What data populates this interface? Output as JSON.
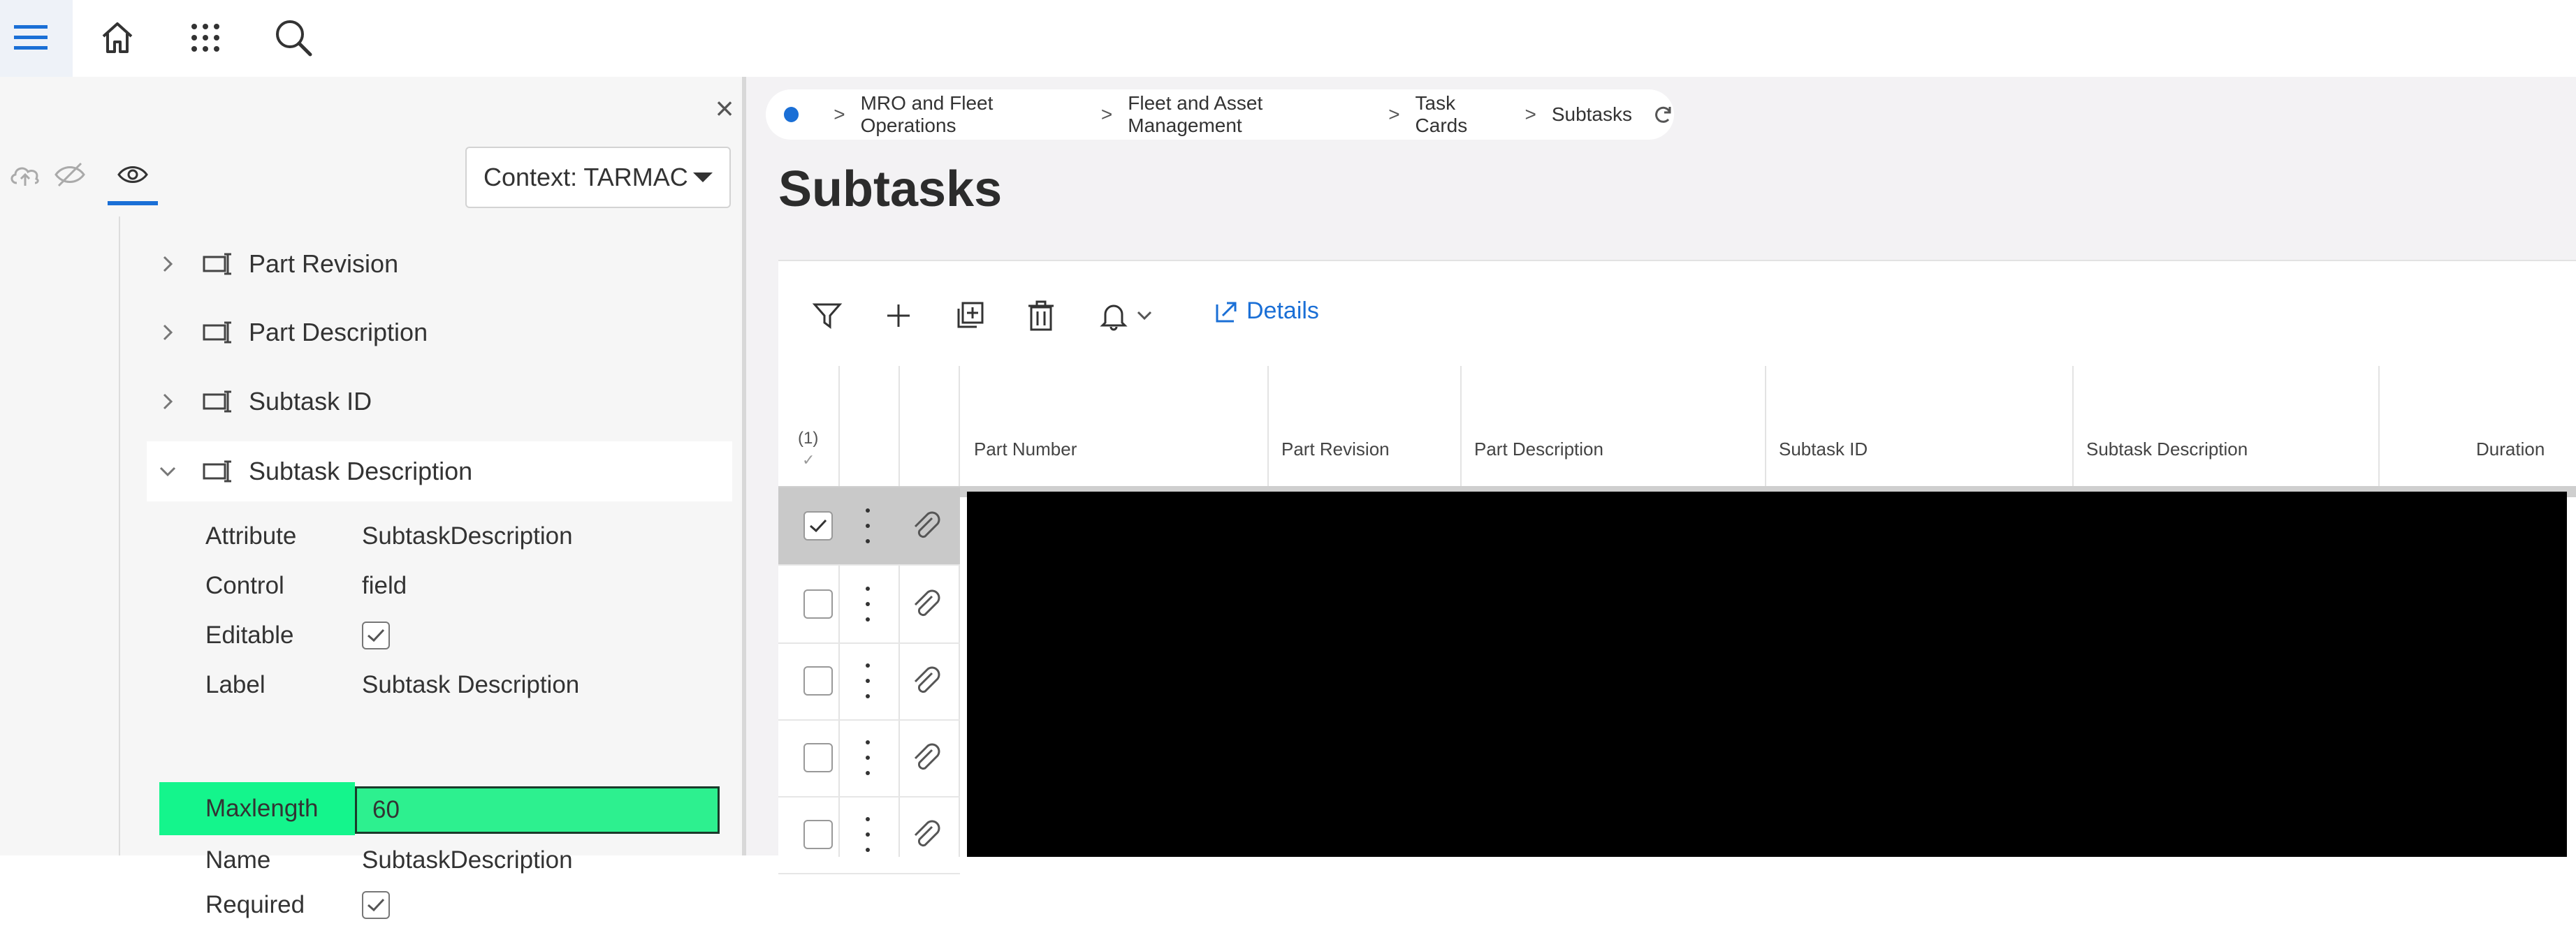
{
  "topbar": {
    "icons": [
      "hamburger-menu-icon",
      "home-icon",
      "apps-grid-icon",
      "search-icon"
    ]
  },
  "panel": {
    "close_label": "×",
    "view_icons": [
      "cloud-upload-icon",
      "eye-off-icon",
      "eye-icon"
    ],
    "context_label": "Context: TARMAC",
    "tree": [
      {
        "label": "Part Revision",
        "expanded": false
      },
      {
        "label": "Part Description",
        "expanded": false
      },
      {
        "label": "Subtask ID",
        "expanded": false
      },
      {
        "label": "Subtask Description",
        "expanded": true
      }
    ],
    "properties": [
      {
        "key": "Attribute",
        "value": "SubtaskDescription"
      },
      {
        "key": "Control",
        "value": "field"
      },
      {
        "key": "Editable",
        "value": "",
        "checkbox": true
      },
      {
        "key": "Label",
        "value": "Subtask Description"
      },
      {
        "key": "Maxlength",
        "value": "60",
        "highlight": true
      },
      {
        "key": "Name",
        "value": "SubtaskDescription"
      },
      {
        "key": "Required",
        "value": "",
        "checkbox": true
      }
    ]
  },
  "breadcrumb": {
    "items": [
      "MRO and Fleet Operations",
      "Fleet and Asset Management",
      "Task Cards",
      "Subtasks"
    ],
    "separator": ">"
  },
  "page": {
    "title": "Subtasks"
  },
  "toolbar": {
    "icons": [
      "filter-icon",
      "add-icon",
      "duplicate-icon",
      "delete-icon",
      "bell-icon"
    ],
    "details_label": "Details"
  },
  "table": {
    "selection_count": "(1)",
    "selection_tick": "✓",
    "columns": [
      "Part Number",
      "Part Revision",
      "Part Description",
      "Subtask ID",
      "Subtask Description",
      "Duration"
    ],
    "rows": [
      {
        "selected": true
      },
      {
        "selected": false
      },
      {
        "selected": false
      },
      {
        "selected": false
      },
      {
        "selected": false
      }
    ]
  },
  "colors": {
    "accent": "#1a6fd6",
    "highlight": "#14f58c",
    "redaction": "#000000"
  }
}
